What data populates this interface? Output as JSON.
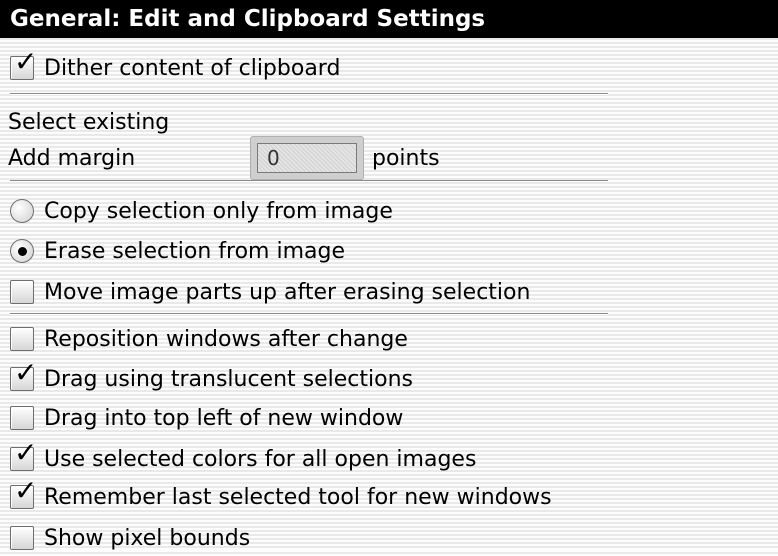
{
  "panel": {
    "title": "General: Edit and Clipboard Settings"
  },
  "clipboard": {
    "dither_label": "Dither content of clipboard",
    "dither_checked": true
  },
  "select_existing": {
    "label": "Select existing",
    "margin_label": "Add margin",
    "margin_value": "0",
    "margin_unit": "points"
  },
  "selection_mode": {
    "copy_label": "Copy selection only from image",
    "erase_label": "Erase selection from image",
    "selected": "erase",
    "move_parts_label": "Move image parts up after erasing selection",
    "move_parts_checked": false
  },
  "window_options": [
    {
      "label": "Reposition windows after change",
      "checked": false
    },
    {
      "label": "Drag using translucent selections",
      "checked": true
    },
    {
      "label": "Drag into top left of new window",
      "checked": false
    },
    {
      "label": "Use selected colors for all open images",
      "checked": true
    },
    {
      "label": "Remember last selected tool for new windows",
      "checked": true
    },
    {
      "label": "Show pixel bounds",
      "checked": false
    }
  ]
}
